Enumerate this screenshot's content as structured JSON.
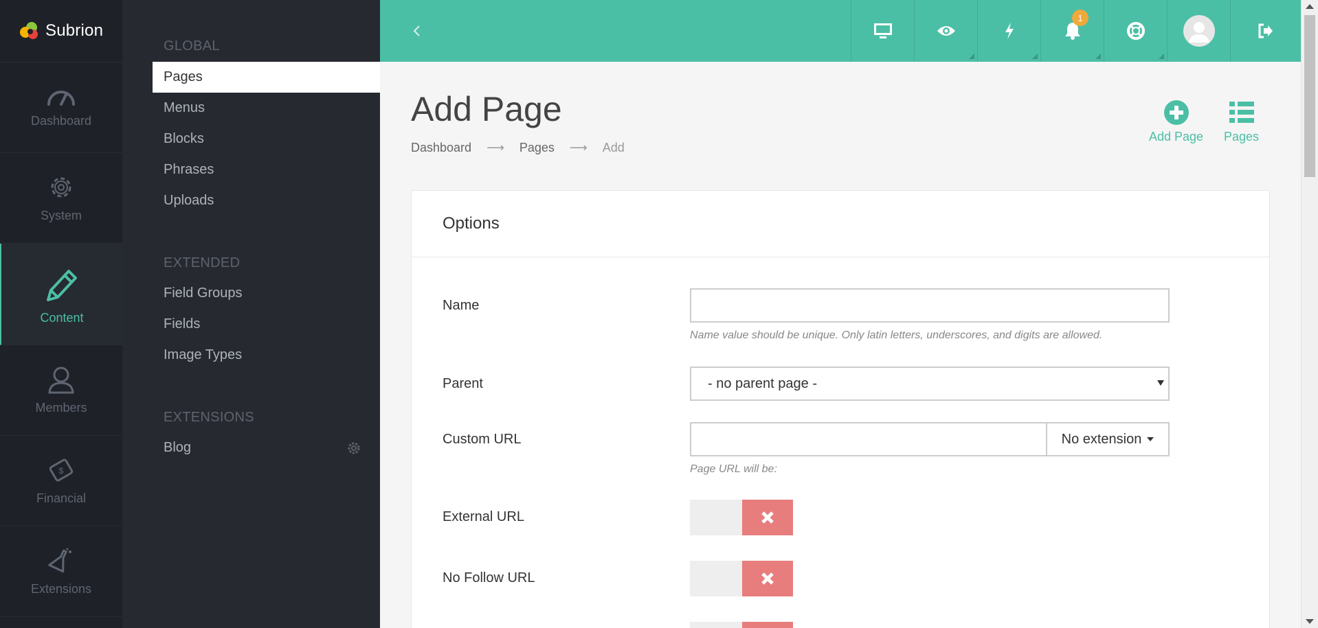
{
  "brand": {
    "name": "Subrion"
  },
  "rail": [
    {
      "label": "Dashboard",
      "icon": "speedometer-icon"
    },
    {
      "label": "System",
      "icon": "gear-icon"
    },
    {
      "label": "Content",
      "icon": "pencil-icon",
      "active": true
    },
    {
      "label": "Members",
      "icon": "user-icon"
    },
    {
      "label": "Financial",
      "icon": "money-icon"
    },
    {
      "label": "Extensions",
      "icon": "flask-icon"
    }
  ],
  "submenu": {
    "groups": [
      "GLOBAL",
      "EXTENDED",
      "EXTENSIONS"
    ],
    "global_items": [
      "Pages",
      "Menus",
      "Blocks",
      "Phrases",
      "Uploads"
    ],
    "extended_items": [
      "Field Groups",
      "Fields",
      "Image Types"
    ],
    "extension_items": [
      "Blog"
    ]
  },
  "topbar": {
    "notification_count": "1"
  },
  "page": {
    "title": "Add Page",
    "breadcrumb": [
      "Dashboard",
      "Pages",
      "Add"
    ],
    "breadcrumb_separator": "⟶",
    "actions": {
      "add_page": "Add Page",
      "pages": "Pages"
    }
  },
  "form": {
    "card_title": "Options",
    "name_label": "Name",
    "name_value": "",
    "name_help": "Name value should be unique. Only latin letters, underscores, and digits are allowed.",
    "parent_label": "Parent",
    "parent_selected": "- no parent page -",
    "custom_url_label": "Custom URL",
    "custom_url_value": "",
    "extension_selected": "No extension",
    "custom_url_help": "Page URL will be:",
    "external_url_label": "External URL",
    "external_url_state": "off",
    "nofollow_label": "No Follow URL",
    "nofollow_state": "off"
  },
  "colors": {
    "accent": "#4bbfa5",
    "toggle_off": "#e87d7d",
    "badge": "#f0a93b"
  }
}
